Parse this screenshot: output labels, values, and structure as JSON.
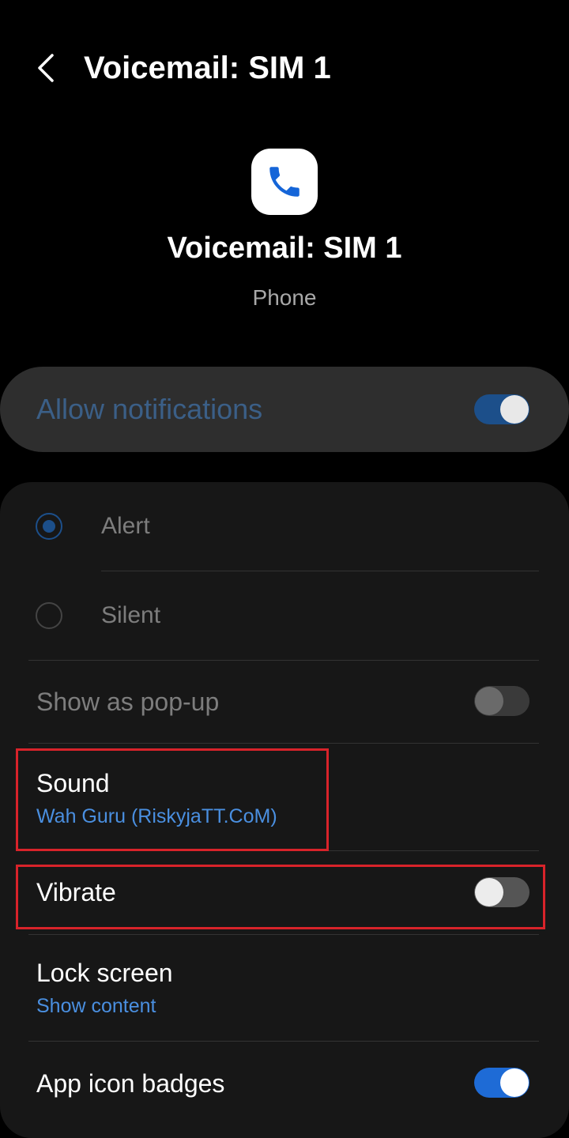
{
  "header": {
    "title": "Voicemail: SIM 1"
  },
  "app": {
    "name": "Voicemail: SIM 1",
    "category": "Phone",
    "icon": "phone-icon"
  },
  "allow_notifications": {
    "label": "Allow notifications",
    "enabled": true
  },
  "alert_mode": {
    "options": [
      {
        "label": "Alert",
        "selected": true
      },
      {
        "label": "Silent",
        "selected": false
      }
    ]
  },
  "settings": {
    "popup": {
      "label": "Show as pop-up",
      "enabled": false
    },
    "sound": {
      "label": "Sound",
      "value": "Wah Guru (RiskyjaTT.CoM)"
    },
    "vibrate": {
      "label": "Vibrate",
      "enabled": false
    },
    "lock_screen": {
      "label": "Lock screen",
      "value": "Show content"
    },
    "badges": {
      "label": "App icon badges",
      "enabled": true
    }
  },
  "colors": {
    "accent": "#1e6bd6",
    "highlight": "#d8232a",
    "link": "#4a8fe0"
  }
}
